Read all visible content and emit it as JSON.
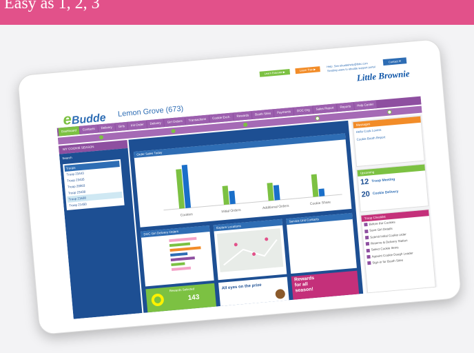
{
  "banner": {
    "title": "Easy as 1, 2, 3"
  },
  "header": {
    "btn1": "Learn Educate ▶",
    "btn2": "Learn Trax ▶",
    "help1": "Help: See ebuddehelp@lbbc.com",
    "help2": "Sending users to ebudde support portal",
    "contact": "Contact ✉",
    "brand": "Little Brownie",
    "app_name": "Budde",
    "council": "Lemon Grove (673)"
  },
  "nav": [
    "Dashboard",
    "Contacts",
    "Delivery",
    "Girls",
    "Init Order",
    "Delivery",
    "Girl Orders",
    "Transactions",
    "Cookie Exch.",
    "Rewards",
    "Booth Sites",
    "Payments",
    "DOC Org",
    "Sales Report",
    "Reports",
    "Help Center"
  ],
  "season": "MY COOKIE SEASON",
  "sidebar": {
    "search": "Search",
    "header": "Troops",
    "troops": [
      "Troop 23443",
      "Troop 23435",
      "Troop 28003",
      "Troop 23438",
      "Troop 21638",
      "Troop 21450"
    ]
  },
  "main": {
    "order_sales_title": "Order Sales Today",
    "doc_title": "DOC Girl Delivery Orders",
    "explore_title": "Explore Locations",
    "service_title": "Service Unit Contacts",
    "rewards_title": "Rewards Selected",
    "rewards_value": "143",
    "prize_title": "All eyes on the prize",
    "season_line1": "Rewards",
    "season_line2": "for all",
    "season_line3": "season!"
  },
  "right": {
    "messages_title": "Messages",
    "msg1": "Hello Cook Lovers",
    "msg2": "Cookie Booth Report",
    "upcoming_title": "Upcoming",
    "events": [
      {
        "day": "12",
        "title": "Troop Meeting"
      },
      {
        "day": "20",
        "title": "Cookie Delivery"
      }
    ],
    "checklist_title": "Troop Checklist",
    "checklist": [
      "Before the Cookies",
      "Save Girl Details",
      "Submit Initial Cookie order",
      "Reserve & Delivery Station",
      "Select Cookie Items",
      "Appoint Cookie Dough Leader",
      "Sign-in for Booth Sites"
    ]
  },
  "chart_data": {
    "type": "bar",
    "categories": [
      "Cookies",
      "Initial Orders",
      "Additional Orders",
      "Cookie Share"
    ],
    "series": [
      {
        "color": "#7cc142",
        "values": [
          4200,
          2000,
          1900,
          2400
        ]
      },
      {
        "color": "#1a6fc9",
        "values": [
          4600,
          1400,
          1600,
          800
        ]
      }
    ],
    "ylim": [
      0,
      5000
    ]
  }
}
